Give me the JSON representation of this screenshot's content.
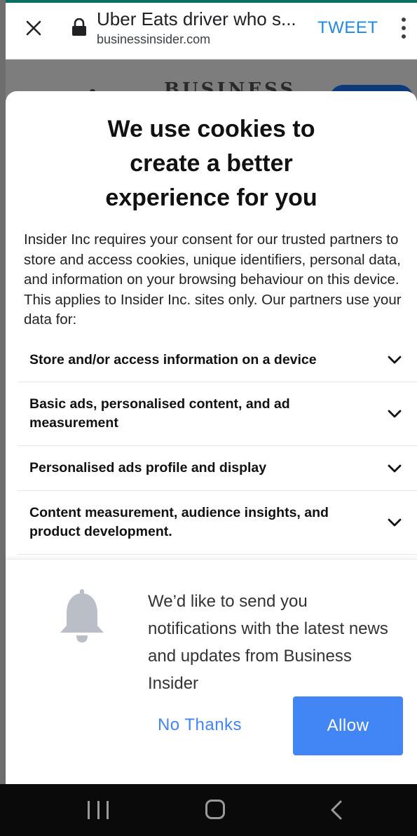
{
  "browser": {
    "title": "Uber Eats driver who s...",
    "url": "businessinsider.com",
    "tweet_label": "TWEET",
    "icons": {
      "close": "close-icon",
      "lock": "lock-icon",
      "more": "more-vert-icon"
    },
    "accent_color": "#1e88e5"
  },
  "background_site": {
    "logo_text": "BUSINESS"
  },
  "cookie_modal": {
    "title": "We use cookies to create a better experience for you",
    "body": "Insider Inc requires your consent for our trusted partners to store and access cookies, unique identifiers, personal data, and information on your browsing behaviour on this device. This applies to Insider Inc. sites only. Our partners use your data for:",
    "purposes": [
      {
        "label": "Store and/or access information on a device"
      },
      {
        "label": "Basic ads, personalised content, and ad measurement"
      },
      {
        "label": "Personalised ads profile and display"
      },
      {
        "label": "Content measurement, audience insights, and product development."
      }
    ]
  },
  "notification_prompt": {
    "message": "We’d like to send you notifications with the latest news and updates from Business Insider",
    "no_thanks_label": "No Thanks",
    "allow_label": "Allow",
    "button_color": "#4285f4"
  },
  "nav_bar": {
    "icons": [
      "recents-icon",
      "home-icon",
      "back-icon"
    ]
  }
}
